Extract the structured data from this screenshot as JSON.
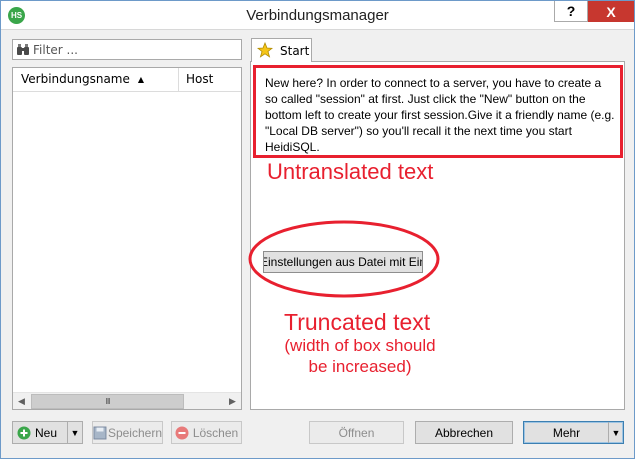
{
  "window": {
    "app_icon_text": "HS",
    "title": "Verbindungsmanager",
    "help": "?",
    "close": "X"
  },
  "filter": {
    "placeholder": "Filter ..."
  },
  "session_list": {
    "columns": [
      "Verbindungsname",
      "Host"
    ],
    "sort_indicator": "▲",
    "scroll_grip": "III",
    "scroll_left": "◀",
    "scroll_right": "▶"
  },
  "tabs": [
    {
      "label": "Start",
      "icon": "star-icon"
    }
  ],
  "start_page": {
    "intro_text": "New here? In order to connect to a server, you have to create a so called \"session\" at first. Just click the \"New\" button on the bottom left to create your first session.Give it a friendly name (e.g. \"Local DB server\") so you'll recall it the next time you start HeidiSQL.",
    "import_button": "Einstellungen aus Datei mit Einstellungen importieren"
  },
  "annotations": {
    "untranslated": "Untranslated text",
    "truncated": "Truncated text",
    "truncated_note_1": "(width of box should",
    "truncated_note_2": "be increased)",
    "color": "#e8202f"
  },
  "bottom_buttons": {
    "new": "Neu",
    "save": "Speichern",
    "delete": "Löschen",
    "open": "Öffnen",
    "cancel": "Abbrechen",
    "more": "Mehr",
    "dropdown_arrow": "▼"
  }
}
